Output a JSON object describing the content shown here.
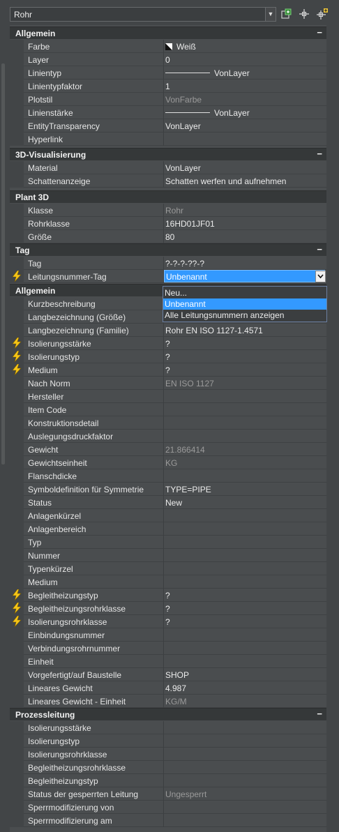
{
  "selector": {
    "value": "Rohr"
  },
  "toolbar": {
    "quick_select_icon": "quick-select-icon",
    "select_objects_icon": "select-objects-icon",
    "toggle_pickadd_icon": "toggle-pickadd-icon"
  },
  "sections": {
    "allgemein": {
      "title": "Allgemein",
      "toggle": "−",
      "rows": [
        {
          "name": "Farbe",
          "value": "Weiß"
        },
        {
          "name": "Layer",
          "value": "0"
        },
        {
          "name": "Linientyp",
          "value": "VonLayer"
        },
        {
          "name": "Linientypfaktor",
          "value": "1"
        },
        {
          "name": "Plotstil",
          "value": "VonFarbe"
        },
        {
          "name": "Linienstärke",
          "value": "VonLayer"
        },
        {
          "name": "EntityTransparency",
          "value": "VonLayer"
        },
        {
          "name": "Hyperlink",
          "value": ""
        }
      ]
    },
    "vis3d": {
      "title": "3D-Visualisierung",
      "toggle": "−",
      "rows": [
        {
          "name": "Material",
          "value": "VonLayer"
        },
        {
          "name": "Schattenanzeige",
          "value": "Schatten werfen und aufnehmen"
        }
      ]
    },
    "plant3d": {
      "title": "Plant 3D",
      "toggle": "",
      "rows": [
        {
          "name": "Klasse",
          "value": "Rohr"
        },
        {
          "name": "Rohrklasse",
          "value": "16HD01JF01"
        },
        {
          "name": "Größe",
          "value": "80"
        }
      ]
    },
    "tag": {
      "title": "Tag",
      "toggle": "−",
      "rows": [
        {
          "name": "Tag",
          "value": "?-?-?-??-?"
        },
        {
          "name": "Leitungsnummer-Tag",
          "value": "Unbenannt"
        }
      ]
    },
    "allgemein2": {
      "title": "Allgemein",
      "toggle": "",
      "rows": [
        {
          "name": "Kurzbeschreibung",
          "value": ""
        },
        {
          "name": "Langbezeichnung (Größe)",
          "value": ""
        },
        {
          "name": "Langbezeichnung (Familie)",
          "value": "Rohr EN ISO 1127-1.4571"
        },
        {
          "name": "Isolierungsstärke",
          "value": "?"
        },
        {
          "name": "Isolierungstyp",
          "value": "?"
        },
        {
          "name": "Medium",
          "value": "?"
        },
        {
          "name": "Nach Norm",
          "value": "EN ISO 1127"
        },
        {
          "name": "Hersteller",
          "value": ""
        },
        {
          "name": "Item Code",
          "value": ""
        },
        {
          "name": "Konstruktionsdetail",
          "value": ""
        },
        {
          "name": "Auslegungsdruckfaktor",
          "value": ""
        },
        {
          "name": "Gewicht",
          "value": "21.866414"
        },
        {
          "name": "Gewichtseinheit",
          "value": "KG"
        },
        {
          "name": "Flanschdicke",
          "value": ""
        },
        {
          "name": "Symboldefinition für Symmetrie",
          "value": "TYPE=PIPE"
        },
        {
          "name": "Status",
          "value": "New"
        },
        {
          "name": "Anlagenkürzel",
          "value": ""
        },
        {
          "name": "Anlagenbereich",
          "value": ""
        },
        {
          "name": "Typ",
          "value": ""
        },
        {
          "name": "Nummer",
          "value": ""
        },
        {
          "name": "Typenkürzel",
          "value": ""
        },
        {
          "name": "Medium",
          "value": ""
        },
        {
          "name": "Begleitheizungstyp",
          "value": "?"
        },
        {
          "name": "Begleitheizungsrohrklasse",
          "value": "?"
        },
        {
          "name": "Isolierungsrohrklasse",
          "value": "?"
        },
        {
          "name": "Einbindungsnummer",
          "value": ""
        },
        {
          "name": "Verbindungsrohrnummer",
          "value": ""
        },
        {
          "name": "Einheit",
          "value": ""
        },
        {
          "name": "Vorgefertigt/auf Baustelle",
          "value": "SHOP"
        },
        {
          "name": "Lineares Gewicht",
          "value": "4.987"
        },
        {
          "name": "Lineares Gewicht - Einheit",
          "value": "KG/M"
        }
      ]
    },
    "prozess": {
      "title": "Prozessleitung",
      "toggle": "−",
      "rows": [
        {
          "name": "Isolierungsstärke",
          "value": ""
        },
        {
          "name": "Isolierungstyp",
          "value": ""
        },
        {
          "name": "Isolierungsrohrklasse",
          "value": ""
        },
        {
          "name": "Begleitheizungsrohrklasse",
          "value": ""
        },
        {
          "name": "Begleitheizungstyp",
          "value": ""
        },
        {
          "name": "Status der gesperrten Leitung",
          "value": "Ungesperrt"
        },
        {
          "name": "Sperrmodifizierung von",
          "value": ""
        },
        {
          "name": "Sperrmodifizierung am",
          "value": ""
        }
      ]
    }
  },
  "dropdown": {
    "options": [
      "Neu...",
      "Unbenannt",
      "Alle Leitungsnummern anzeigen"
    ],
    "selected": "Unbenannt"
  },
  "colors": {
    "selection": "#3399ff",
    "lightning": "#f5c518"
  },
  "icons": {
    "lightning": "lightning-icon",
    "color_swatch": "color-swatch-icon",
    "dropdown_arrow": "chevron-down-icon"
  }
}
